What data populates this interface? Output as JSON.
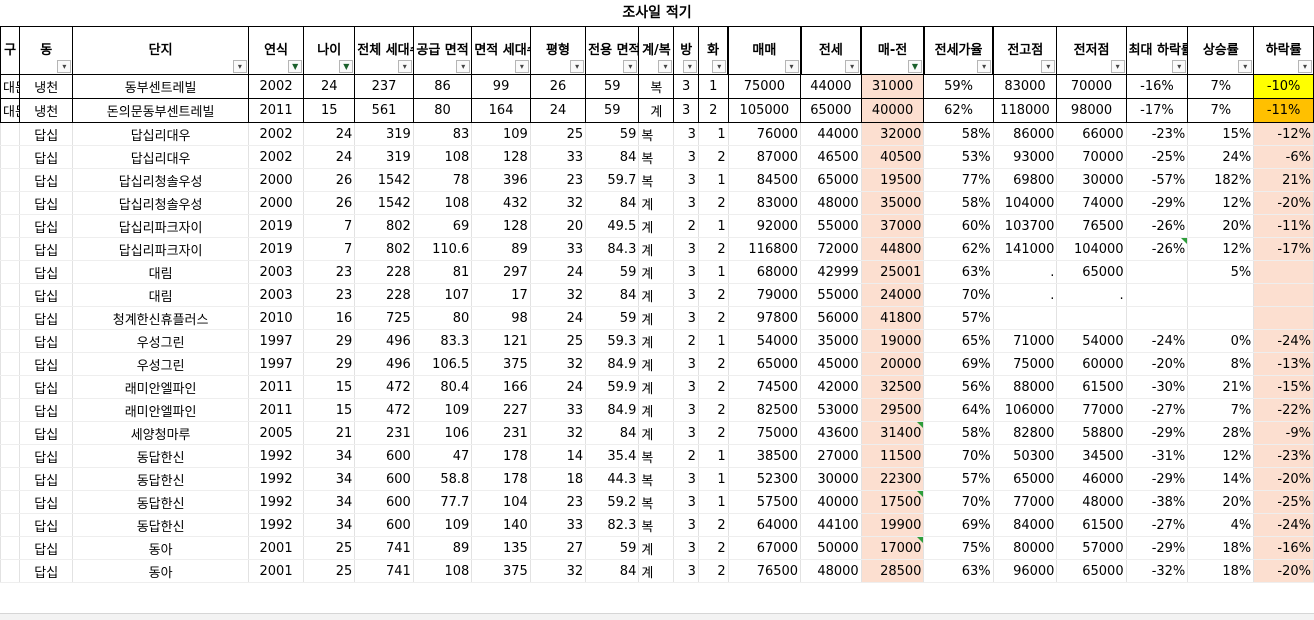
{
  "sheet_title": "조사일 적기",
  "headers": [
    {
      "label": "구",
      "filter": "none"
    },
    {
      "label": "동",
      "filter": "dropdown"
    },
    {
      "label": "단지",
      "filter": "dropdown"
    },
    {
      "label": "연식",
      "filter": "active"
    },
    {
      "label": "나이",
      "filter": "active"
    },
    {
      "label": "전체 세대수",
      "filter": "dropdown"
    },
    {
      "label": "공급 면적",
      "filter": "dropdown"
    },
    {
      "label": "면적 세대수",
      "filter": "dropdown"
    },
    {
      "label": "평형",
      "filter": "dropdown"
    },
    {
      "label": "전용 면적",
      "filter": "dropdown"
    },
    {
      "label": "계/복",
      "filter": "dropdown"
    },
    {
      "label": "방",
      "filter": "dropdown"
    },
    {
      "label": "화",
      "filter": "dropdown"
    },
    {
      "label": "매매",
      "filter": "dropdown"
    },
    {
      "label": "전세",
      "filter": "dropdown"
    },
    {
      "label": "매-전",
      "filter": "active"
    },
    {
      "label": "전세가율",
      "filter": "dropdown"
    },
    {
      "label": "전고점",
      "filter": "dropdown"
    },
    {
      "label": "전저점",
      "filter": "dropdown"
    },
    {
      "label": "최대 하락률",
      "filter": "dropdown"
    },
    {
      "label": "상승률",
      "filter": "dropdown"
    },
    {
      "label": "하락률",
      "filter": "dropdown"
    }
  ],
  "summary_rows": [
    [
      "대문",
      "냉천",
      "동부센트레빌",
      "2002",
      "24",
      "237",
      "86",
      "99",
      "26",
      "59",
      "복",
      "3",
      "1",
      "75000",
      "44000",
      "31000",
      "59%",
      "83000",
      "70000",
      "-16%",
      "7%",
      "-10%"
    ],
    [
      "대문",
      "냉천",
      "돈의문동부센트레빌",
      "2011",
      "15",
      "561",
      "80",
      "164",
      "24",
      "59",
      "계",
      "3",
      "2",
      "105000",
      "65000",
      "40000",
      "62%",
      "118000",
      "98000",
      "-17%",
      "7%",
      "-11%"
    ]
  ],
  "rows": [
    [
      "",
      "답십",
      "답십리대우",
      "2002",
      "24",
      "319",
      "83",
      "109",
      "25",
      "59",
      "복",
      "3",
      "1",
      "76000",
      "44000",
      "32000",
      "58%",
      "86000",
      "66000",
      "-23%",
      "15%",
      "-12%"
    ],
    [
      "",
      "답십",
      "답십리대우",
      "2002",
      "24",
      "319",
      "108",
      "128",
      "33",
      "84",
      "복",
      "3",
      "2",
      "87000",
      "46500",
      "40500",
      "53%",
      "93000",
      "70000",
      "-25%",
      "24%",
      "-6%"
    ],
    [
      "",
      "답십",
      "답십리청솔우성",
      "2000",
      "26",
      "1542",
      "78",
      "396",
      "23",
      "59.7",
      "복",
      "3",
      "1",
      "84500",
      "65000",
      "19500",
      "77%",
      "69800",
      "30000",
      "-57%",
      "182%",
      "21%"
    ],
    [
      "",
      "답십",
      "답십리청솔우성",
      "2000",
      "26",
      "1542",
      "108",
      "432",
      "32",
      "84",
      "계",
      "3",
      "2",
      "83000",
      "48000",
      "35000",
      "58%",
      "104000",
      "74000",
      "-29%",
      "12%",
      "-20%"
    ],
    [
      "",
      "답십",
      "답십리파크자이",
      "2019",
      "7",
      "802",
      "69",
      "128",
      "20",
      "49.5",
      "계",
      "2",
      "1",
      "92000",
      "55000",
      "37000",
      "60%",
      "103700",
      "76500",
      "-26%",
      "20%",
      "-11%"
    ],
    [
      "",
      "답십",
      "답십리파크자이",
      "2019",
      "7",
      "802",
      "110.6",
      "89",
      "33",
      "84.3",
      "계",
      "3",
      "2",
      "116800",
      "72000",
      "44800",
      "62%",
      "141000",
      "104000",
      "-26%",
      "12%",
      "-17%"
    ],
    [
      "",
      "답십",
      "대림",
      "2003",
      "23",
      "228",
      "81",
      "297",
      "24",
      "59",
      "계",
      "3",
      "1",
      "68000",
      "42999",
      "25001",
      "63%",
      ".",
      "65000",
      "",
      "5%",
      ""
    ],
    [
      "",
      "답십",
      "대림",
      "2003",
      "23",
      "228",
      "107",
      "17",
      "32",
      "84",
      "계",
      "3",
      "2",
      "79000",
      "55000",
      "24000",
      "70%",
      ".",
      ".",
      "",
      "",
      ""
    ],
    [
      "",
      "답십",
      "청계한신휴플러스",
      "2010",
      "16",
      "725",
      "80",
      "98",
      "24",
      "59",
      "계",
      "3",
      "2",
      "97800",
      "56000",
      "41800",
      "57%",
      "",
      "",
      "",
      "",
      ""
    ],
    [
      "",
      "답십",
      "우성그린",
      "1997",
      "29",
      "496",
      "83.3",
      "121",
      "25",
      "59.3",
      "계",
      "2",
      "1",
      "54000",
      "35000",
      "19000",
      "65%",
      "71000",
      "54000",
      "-24%",
      "0%",
      "-24%"
    ],
    [
      "",
      "답십",
      "우성그린",
      "1997",
      "29",
      "496",
      "106.5",
      "375",
      "32",
      "84.9",
      "계",
      "3",
      "2",
      "65000",
      "45000",
      "20000",
      "69%",
      "75000",
      "60000",
      "-20%",
      "8%",
      "-13%"
    ],
    [
      "",
      "답십",
      "래미안엘파인",
      "2011",
      "15",
      "472",
      "80.4",
      "166",
      "24",
      "59.9",
      "계",
      "3",
      "2",
      "74500",
      "42000",
      "32500",
      "56%",
      "88000",
      "61500",
      "-30%",
      "21%",
      "-15%"
    ],
    [
      "",
      "답십",
      "래미안엘파인",
      "2011",
      "15",
      "472",
      "109",
      "227",
      "33",
      "84.9",
      "계",
      "3",
      "2",
      "82500",
      "53000",
      "29500",
      "64%",
      "106000",
      "77000",
      "-27%",
      "7%",
      "-22%"
    ],
    [
      "",
      "답십",
      "세양청마루",
      "2005",
      "21",
      "231",
      "106",
      "231",
      "32",
      "84",
      "계",
      "3",
      "2",
      "75000",
      "43600",
      "31400",
      "58%",
      "82800",
      "58800",
      "-29%",
      "28%",
      "-9%"
    ],
    [
      "",
      "답십",
      "동답한신",
      "1992",
      "34",
      "600",
      "47",
      "178",
      "14",
      "35.4",
      "복",
      "2",
      "1",
      "38500",
      "27000",
      "11500",
      "70%",
      "50300",
      "34500",
      "-31%",
      "12%",
      "-23%"
    ],
    [
      "",
      "답십",
      "동답한신",
      "1992",
      "34",
      "600",
      "58.8",
      "178",
      "18",
      "44.3",
      "복",
      "3",
      "1",
      "52300",
      "30000",
      "22300",
      "57%",
      "65000",
      "46000",
      "-29%",
      "14%",
      "-20%"
    ],
    [
      "",
      "답십",
      "동답한신",
      "1992",
      "34",
      "600",
      "77.7",
      "104",
      "23",
      "59.2",
      "복",
      "3",
      "1",
      "57500",
      "40000",
      "17500",
      "70%",
      "77000",
      "48000",
      "-38%",
      "20%",
      "-25%"
    ],
    [
      "",
      "답십",
      "동답한신",
      "1992",
      "34",
      "600",
      "109",
      "140",
      "33",
      "82.3",
      "복",
      "3",
      "2",
      "64000",
      "44100",
      "19900",
      "69%",
      "84000",
      "61500",
      "-27%",
      "4%",
      "-24%"
    ],
    [
      "",
      "답십",
      "동아",
      "2001",
      "25",
      "741",
      "89",
      "135",
      "27",
      "59",
      "계",
      "3",
      "2",
      "67000",
      "50000",
      "17000",
      "75%",
      "80000",
      "57000",
      "-29%",
      "18%",
      "-16%"
    ],
    [
      "",
      "답십",
      "동아",
      "2001",
      "25",
      "741",
      "108",
      "375",
      "32",
      "84",
      "계",
      "3",
      "2",
      "76500",
      "48000",
      "28500",
      "63%",
      "96000",
      "65000",
      "-32%",
      "18%",
      "-20%"
    ]
  ],
  "colors": {
    "highlight_peach": "#fcdfd0",
    "highlight_yellow": "#ffff00",
    "highlight_orange": "#ffc000",
    "comment_marker": "#2e9d3b"
  },
  "icons": {
    "filter_dropdown": "dropdown-arrow-icon",
    "filter_active": "funnel-filter-icon"
  }
}
